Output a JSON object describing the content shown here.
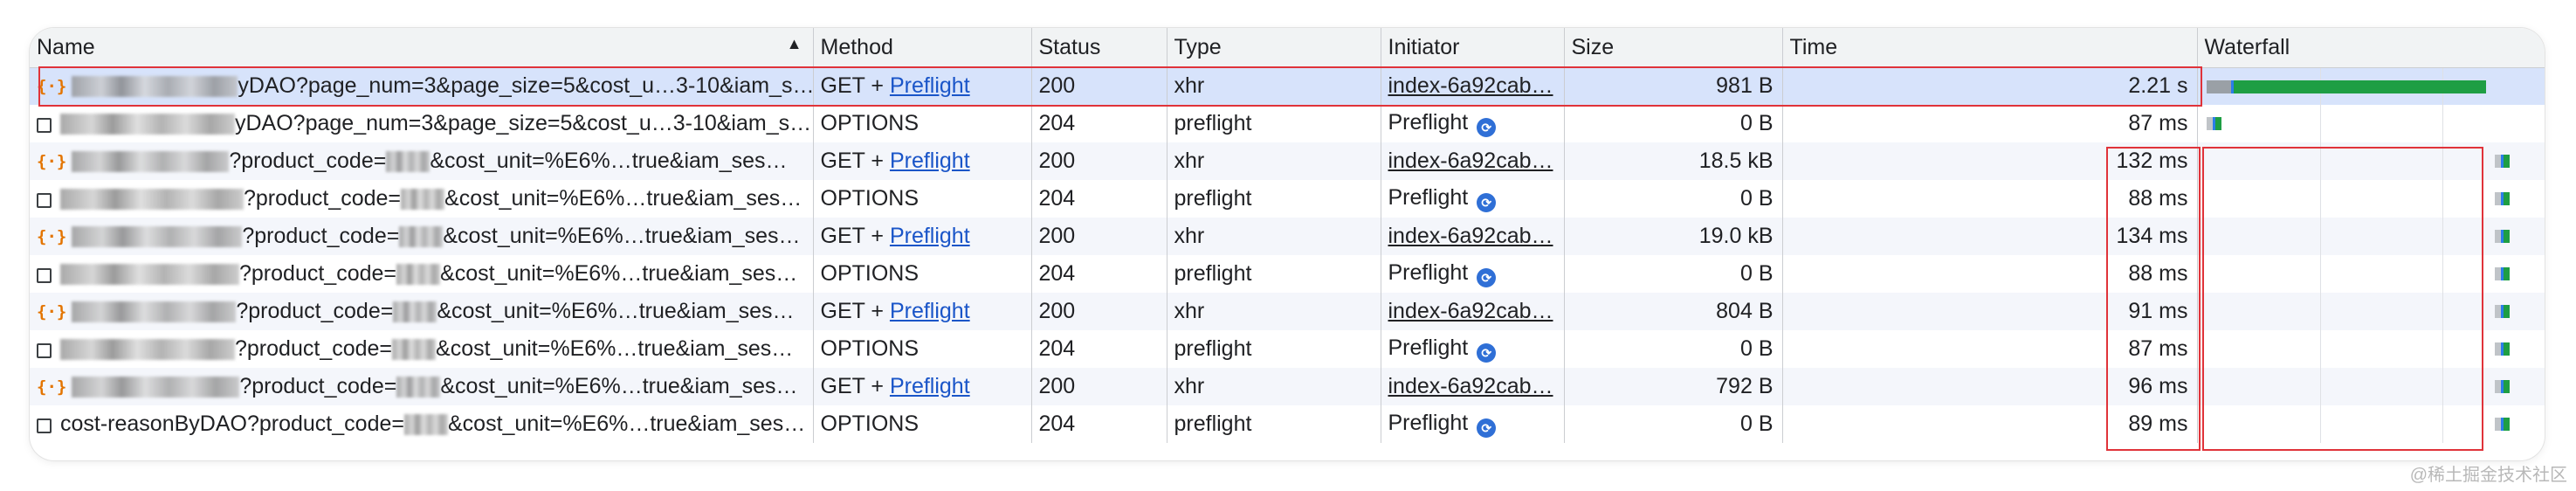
{
  "columns": {
    "name": "Name",
    "method": "Method",
    "status": "Status",
    "type": "Type",
    "initiator": "Initiator",
    "size": "Size",
    "time": "Time",
    "waterfall": "Waterfall"
  },
  "rows": [
    {
      "kind": "xhr",
      "name": "yDAO?page_num=3&page_size=5&cost_u…3-10&iam_s…",
      "method": "GET + ",
      "method_link": "Preflight",
      "status": "200",
      "type": "xhr",
      "initiator": "index-6a92cab…",
      "initiator_link": true,
      "size": "981 B",
      "time": "2.21 s"
    },
    {
      "kind": "doc",
      "name": "yDAO?page_num=3&page_size=5&cost_u…3-10&iam_s…",
      "method": "OPTIONS",
      "method_link": "",
      "status": "204",
      "type": "preflight",
      "initiator": "Preflight",
      "initiator_link": false,
      "size": "0 B",
      "time": "87 ms"
    },
    {
      "kind": "xhr",
      "name": "?product_code=",
      "name2": "&cost_unit=%E6%…true&iam_ses…",
      "method": "GET + ",
      "method_link": "Preflight",
      "status": "200",
      "type": "xhr",
      "initiator": "index-6a92cab…",
      "initiator_link": true,
      "size": "18.5 kB",
      "time": "132 ms"
    },
    {
      "kind": "doc",
      "name": "?product_code=",
      "name2": "&cost_unit=%E6%…true&iam_ses…",
      "method": "OPTIONS",
      "method_link": "",
      "status": "204",
      "type": "preflight",
      "initiator": "Preflight",
      "initiator_link": false,
      "size": "0 B",
      "time": "88 ms"
    },
    {
      "kind": "xhr",
      "name": "?product_code=",
      "name2": "&cost_unit=%E6%…true&iam_ses…",
      "method": "GET + ",
      "method_link": "Preflight",
      "status": "200",
      "type": "xhr",
      "initiator": "index-6a92cab…",
      "initiator_link": true,
      "size": "19.0 kB",
      "time": "134 ms"
    },
    {
      "kind": "doc",
      "name": "?product_code=",
      "name2": "&cost_unit=%E6%…true&iam_ses…",
      "method": "OPTIONS",
      "method_link": "",
      "status": "204",
      "type": "preflight",
      "initiator": "Preflight",
      "initiator_link": false,
      "size": "0 B",
      "time": "88 ms"
    },
    {
      "kind": "xhr",
      "name": "?product_code=",
      "name2": "&cost_unit=%E6%…true&iam_ses…",
      "method": "GET + ",
      "method_link": "Preflight",
      "status": "200",
      "type": "xhr",
      "initiator": "index-6a92cab…",
      "initiator_link": true,
      "size": "804 B",
      "time": "91 ms"
    },
    {
      "kind": "doc",
      "name": "?product_code=",
      "name2": "&cost_unit=%E6%…true&iam_ses…",
      "method": "OPTIONS",
      "method_link": "",
      "status": "204",
      "type": "preflight",
      "initiator": "Preflight",
      "initiator_link": false,
      "size": "0 B",
      "time": "87 ms"
    },
    {
      "kind": "xhr",
      "name": "?product_code=",
      "name2": "&cost_unit=%E6%…true&iam_ses…",
      "method": "GET + ",
      "method_link": "Preflight",
      "status": "200",
      "type": "xhr",
      "initiator": "index-6a92cab…",
      "initiator_link": true,
      "size": "792 B",
      "time": "96 ms"
    },
    {
      "kind": "doc",
      "name": "cost-reasonByDAO?product_code=",
      "name2": "&cost_unit=%E6%…true&iam_ses…",
      "method": "OPTIONS",
      "method_link": "",
      "status": "204",
      "type": "preflight",
      "initiator": "Preflight",
      "initiator_link": false,
      "size": "0 B",
      "time": "89 ms"
    }
  ],
  "waterfall_relative_duration": [
    1.0,
    0.039,
    0.06,
    0.04,
    0.061,
    0.04,
    0.041,
    0.039,
    0.043,
    0.04
  ],
  "waterfall_colors": {
    "queue": "#9aa0a6",
    "receive": "#1e9e44",
    "start": "#2b7de9",
    "waiting": "#34a853"
  },
  "watermark": "@稀土掘金技术社区",
  "icons": {
    "xhr": "xhr-brace-icon",
    "doc": "checkbox-icon",
    "preflight": "preflight-icon",
    "sort": "sort-up-icon"
  }
}
